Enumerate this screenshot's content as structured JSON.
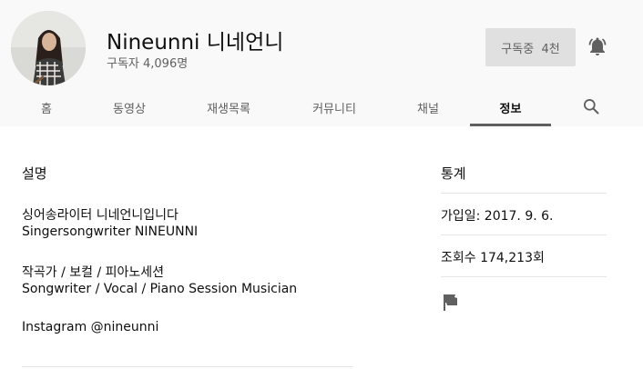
{
  "channel": {
    "name": "Nineunni 니네언니",
    "subscribers": "구독자 4,096명"
  },
  "subscribe": {
    "label": "구독중  4천"
  },
  "tabs": [
    {
      "label": "홈"
    },
    {
      "label": "동영상"
    },
    {
      "label": "재생목록"
    },
    {
      "label": "커뮤니티"
    },
    {
      "label": "채널"
    },
    {
      "label": "정보",
      "active": true
    }
  ],
  "description": {
    "title": "설명",
    "lines": [
      "싱어송라이터 니네언니입니다",
      "Singersongwriter NINEUNNI",
      "작곡가 / 보컬 / 피아노세션",
      "Songwriter / Vocal / Piano Session Musician",
      "Instagram @nineunni"
    ]
  },
  "stats": {
    "title": "통계",
    "joined": "가입일: 2017. 9. 6.",
    "views": "조회수 174,213회"
  },
  "icons": {
    "bell": "bell-icon",
    "search": "search-icon",
    "flag": "flag-icon"
  },
  "colors": {
    "header_bg": "#f9f9f9",
    "subscribe_bg": "#e0e0e0",
    "icon": "#606060"
  }
}
